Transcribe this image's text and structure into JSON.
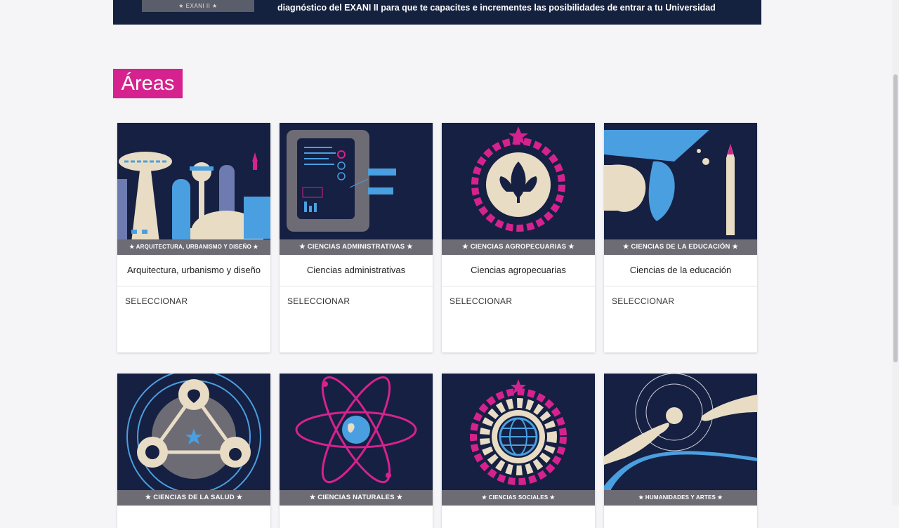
{
  "banner": {
    "logo_text": "★ EXANI II ★",
    "tagline": "diagnóstico del EXANI II para que te capacites e incrementes las posibilidades de entrar a tu Universidad"
  },
  "section": {
    "title": "Áreas"
  },
  "select_label": "SELECCIONAR",
  "areas": [
    {
      "ribbon": "★ ARQUITECTURA, URBANISMO Y DISEÑO ★",
      "name": "Arquitectura, urbanismo y diseño",
      "icon": "city-icon"
    },
    {
      "ribbon": "★ CIENCIAS ADMINISTRATIVAS ★",
      "name": "Ciencias administrativas",
      "icon": "tablet-icon"
    },
    {
      "ribbon": "★ CIENCIAS AGROPECUARIAS ★",
      "name": "Ciencias agropecuarias",
      "icon": "leaf-icon"
    },
    {
      "ribbon": "★ CIENCIAS DE LA EDUCACIÓN ★",
      "name": "Ciencias de la educación",
      "icon": "graduate-icon"
    },
    {
      "ribbon": "★ CIENCIAS DE LA SALUD ★",
      "icon": "health-icon"
    },
    {
      "ribbon": "★ CIENCIAS NATURALES ★",
      "icon": "atom-icon"
    },
    {
      "ribbon": "★ CIENCIAS SOCIALES ★",
      "icon": "globe-gear-icon"
    },
    {
      "ribbon": "★ HUMANIDADES Y ARTES ★",
      "icon": "hands-icon"
    }
  ],
  "colors": {
    "navy": "#152042",
    "magenta": "#d6228e",
    "ribbon": "#6d6b74",
    "sky": "#4a9fe0",
    "cream": "#e8dcc4"
  }
}
